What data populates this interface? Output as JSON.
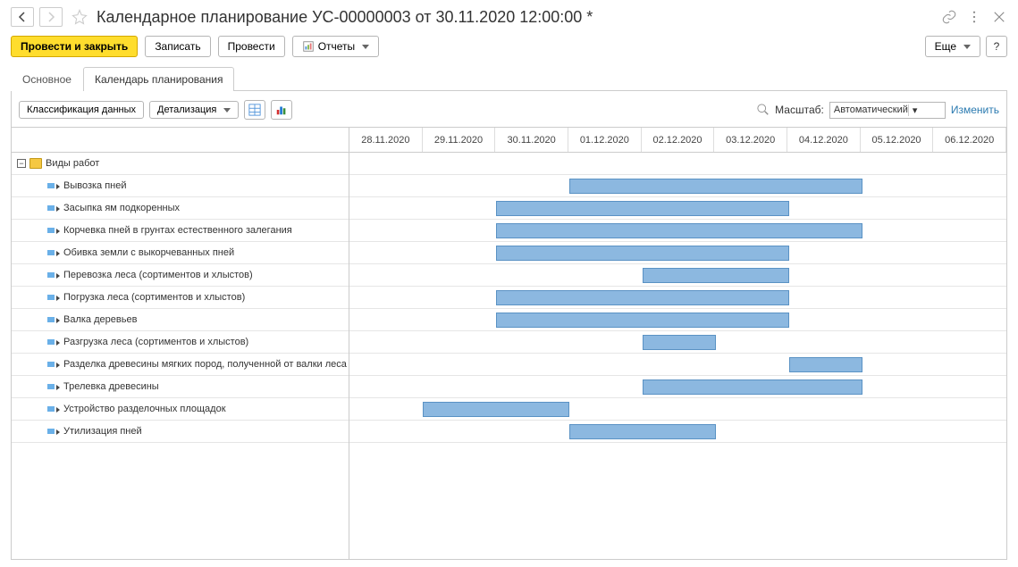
{
  "header": {
    "title": "Календарное планирование УС-00000003 от 30.11.2020 12:00:00 *"
  },
  "toolbar": {
    "post_and_close": "Провести и закрыть",
    "save": "Записать",
    "post": "Провести",
    "reports": "Отчеты",
    "more": "Еще",
    "help": "?"
  },
  "tabs": {
    "main": "Основное",
    "calendar": "Календарь планирования"
  },
  "subtoolbar": {
    "classification": "Классификация данных",
    "detail": "Детализация",
    "scale_label": "Масштаб:",
    "scale_value": "Автоматический",
    "change": "Изменить"
  },
  "dates": [
    "28.11.2020",
    "29.11.2020",
    "30.11.2020",
    "01.12.2020",
    "02.12.2020",
    "03.12.2020",
    "04.12.2020",
    "05.12.2020",
    "06.12.2020"
  ],
  "group_label": "Виды работ",
  "tasks": [
    {
      "name": "Вывозка пней",
      "start": 3,
      "end": 7
    },
    {
      "name": "Засыпка ям подкоренных",
      "start": 2,
      "end": 6
    },
    {
      "name": "Корчевка пней в грунтах естественного залегания",
      "start": 2,
      "end": 7
    },
    {
      "name": "Обивка земли с выкорчеванных пней",
      "start": 2,
      "end": 6
    },
    {
      "name": "Перевозка леса (сортиментов и хлыстов)",
      "start": 4,
      "end": 6
    },
    {
      "name": "Погрузка леса (сортиментов и хлыстов)",
      "start": 2,
      "end": 6
    },
    {
      "name": "Валка деревьев",
      "start": 2,
      "end": 6
    },
    {
      "name": "Разгрузка леса (сортиментов и хлыстов)",
      "start": 4,
      "end": 5
    },
    {
      "name": "Разделка древесины мягких пород, полученной от валки леса",
      "start": 6,
      "end": 7
    },
    {
      "name": "Трелевка древесины",
      "start": 4,
      "end": 7
    },
    {
      "name": "Устройство разделочных площадок",
      "start": 1,
      "end": 3
    },
    {
      "name": "Утилизация пней",
      "start": 3,
      "end": 5
    }
  ],
  "chart_data": {
    "type": "gantt",
    "x_categories": [
      "28.11.2020",
      "29.11.2020",
      "30.11.2020",
      "01.12.2020",
      "02.12.2020",
      "03.12.2020",
      "04.12.2020",
      "05.12.2020",
      "06.12.2020"
    ],
    "series": [
      {
        "name": "Вывозка пней",
        "start": "01.12.2020",
        "end": "04.12.2020"
      },
      {
        "name": "Засыпка ям подкоренных",
        "start": "30.11.2020",
        "end": "03.12.2020"
      },
      {
        "name": "Корчевка пней в грунтах естественного залегания",
        "start": "30.11.2020",
        "end": "04.12.2020"
      },
      {
        "name": "Обивка земли с выкорчеванных пней",
        "start": "30.11.2020",
        "end": "03.12.2020"
      },
      {
        "name": "Перевозка леса (сортиментов и хлыстов)",
        "start": "02.12.2020",
        "end": "03.12.2020"
      },
      {
        "name": "Погрузка леса (сортиментов и хлыстов)",
        "start": "30.11.2020",
        "end": "03.12.2020"
      },
      {
        "name": "Валка деревьев",
        "start": "30.11.2020",
        "end": "03.12.2020"
      },
      {
        "name": "Разгрузка леса (сортиментов и хлыстов)",
        "start": "02.12.2020",
        "end": "02.12.2020"
      },
      {
        "name": "Разделка древесины мягких пород, полученной от валки леса",
        "start": "03.12.2020",
        "end": "04.12.2020"
      },
      {
        "name": "Трелевка древесины",
        "start": "02.12.2020",
        "end": "04.12.2020"
      },
      {
        "name": "Устройство разделочных площадок",
        "start": "29.11.2020",
        "end": "30.11.2020"
      },
      {
        "name": "Утилизация пней",
        "start": "01.12.2020",
        "end": "02.12.2020"
      }
    ]
  }
}
